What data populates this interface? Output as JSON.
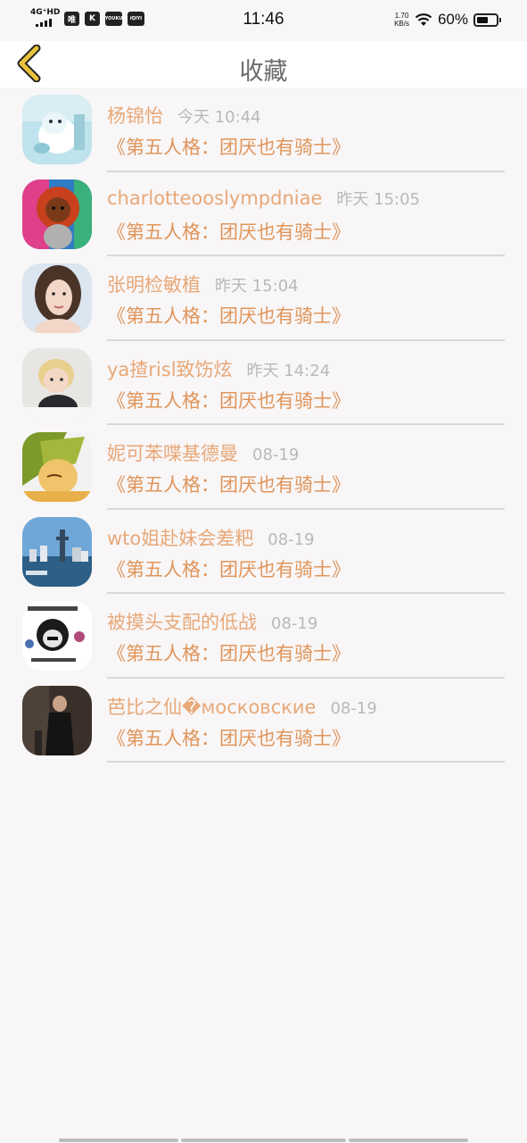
{
  "status_bar": {
    "network": "4G⁺HD",
    "time": "11:46",
    "net_speed_value": "1.70",
    "net_speed_unit": "KB/s",
    "battery_percent": "60%",
    "battery_level": 0.6,
    "app_icons": [
      "唯",
      "K",
      "YOUKU",
      "iQIYI"
    ]
  },
  "nav": {
    "title": "收藏",
    "back_icon": "chevron-left-icon",
    "accent": "#e8c23c"
  },
  "favorites": [
    {
      "name": "杨锦怡",
      "time": "今天 10:44",
      "title": "《第五人格：团厌也有骑士》",
      "avatar": "cartoon-creature-avatar"
    },
    {
      "name": "charlotteooslympdniae",
      "time": "昨天 15:05",
      "title": "《第五人格：团厌也有骑士》",
      "avatar": "bear-hat-child-avatar"
    },
    {
      "name": "张明检敏植",
      "time": "昨天 15:04",
      "title": "《第五人格：团厌也有骑士》",
      "avatar": "woman-portrait-avatar"
    },
    {
      "name": "ya揸risl致饬炫",
      "time": "昨天 14:24",
      "title": "《第五人格：团厌也有骑士》",
      "avatar": "blonde-child-avatar"
    },
    {
      "name": "妮可苯喋基德曼",
      "time": "08-19",
      "title": "《第五人格：团厌也有骑士》",
      "avatar": "anime-character-avatar"
    },
    {
      "name": "wto姐赴妹会差粑",
      "time": "08-19",
      "title": "《第五人格：团厌也有骑士》",
      "avatar": "city-skyline-avatar"
    },
    {
      "name": "被摸头支配的低战",
      "time": "08-19",
      "title": "《第五人格：团厌也有骑士》",
      "avatar": "meme-face-avatar"
    },
    {
      "name": "芭比之仙�московские",
      "time": "08-19",
      "title": "《第五人格：团厌也有骑士》",
      "avatar": "dark-figure-avatar"
    }
  ],
  "colors": {
    "background": "#f8f6f7",
    "name": "#e8a878",
    "title": "#e0955a",
    "time": "#b9b9b9",
    "divider": "#d9d9d9"
  }
}
